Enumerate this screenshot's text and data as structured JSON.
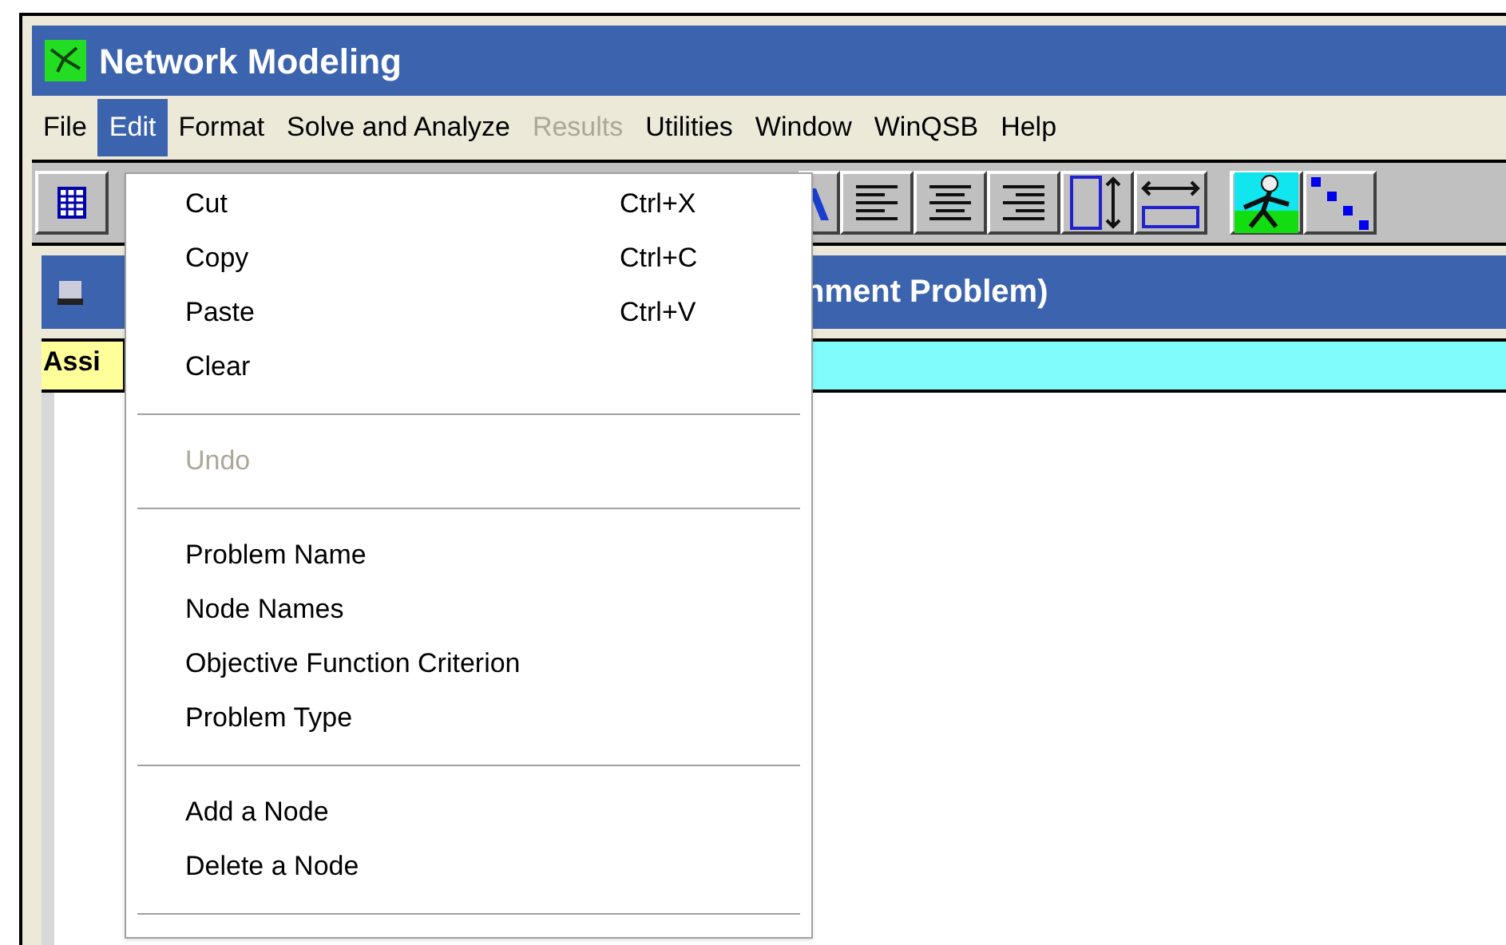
{
  "window": {
    "title": "Network Modeling"
  },
  "menubar": [
    {
      "label": "File",
      "selected": false,
      "disabled": false
    },
    {
      "label": "Edit",
      "selected": true,
      "disabled": false
    },
    {
      "label": "Format",
      "selected": false,
      "disabled": false
    },
    {
      "label": "Solve and Analyze",
      "selected": false,
      "disabled": false
    },
    {
      "label": "Results",
      "selected": false,
      "disabled": true
    },
    {
      "label": "Utilities",
      "selected": false,
      "disabled": false
    },
    {
      "label": "Window",
      "selected": false,
      "disabled": false
    },
    {
      "label": "WinQSB",
      "selected": false,
      "disabled": false
    },
    {
      "label": "Help",
      "selected": false,
      "disabled": false
    }
  ],
  "edit_menu": [
    {
      "kind": "item",
      "label": "Cut",
      "shortcut": "Ctrl+X",
      "disabled": false
    },
    {
      "kind": "item",
      "label": "Copy",
      "shortcut": "Ctrl+C",
      "disabled": false
    },
    {
      "kind": "item",
      "label": "Paste",
      "shortcut": "Ctrl+V",
      "disabled": false
    },
    {
      "kind": "item",
      "label": "Clear",
      "disabled": false
    },
    {
      "kind": "separator"
    },
    {
      "kind": "item",
      "label": "Undo",
      "disabled": true
    },
    {
      "kind": "separator"
    },
    {
      "kind": "item",
      "label": "Problem Name",
      "disabled": false
    },
    {
      "kind": "item",
      "label": "Node Names",
      "disabled": false
    },
    {
      "kind": "item",
      "label": "Objective Function Criterion",
      "disabled": false
    },
    {
      "kind": "item",
      "label": "Problem Type",
      "disabled": false
    },
    {
      "kind": "separator"
    },
    {
      "kind": "item",
      "label": "Add a Node",
      "disabled": false
    },
    {
      "kind": "item",
      "label": "Delete a Node",
      "disabled": false
    },
    {
      "kind": "separator"
    }
  ],
  "child_window": {
    "title": "nment Problem)",
    "row_header": "Assi"
  }
}
